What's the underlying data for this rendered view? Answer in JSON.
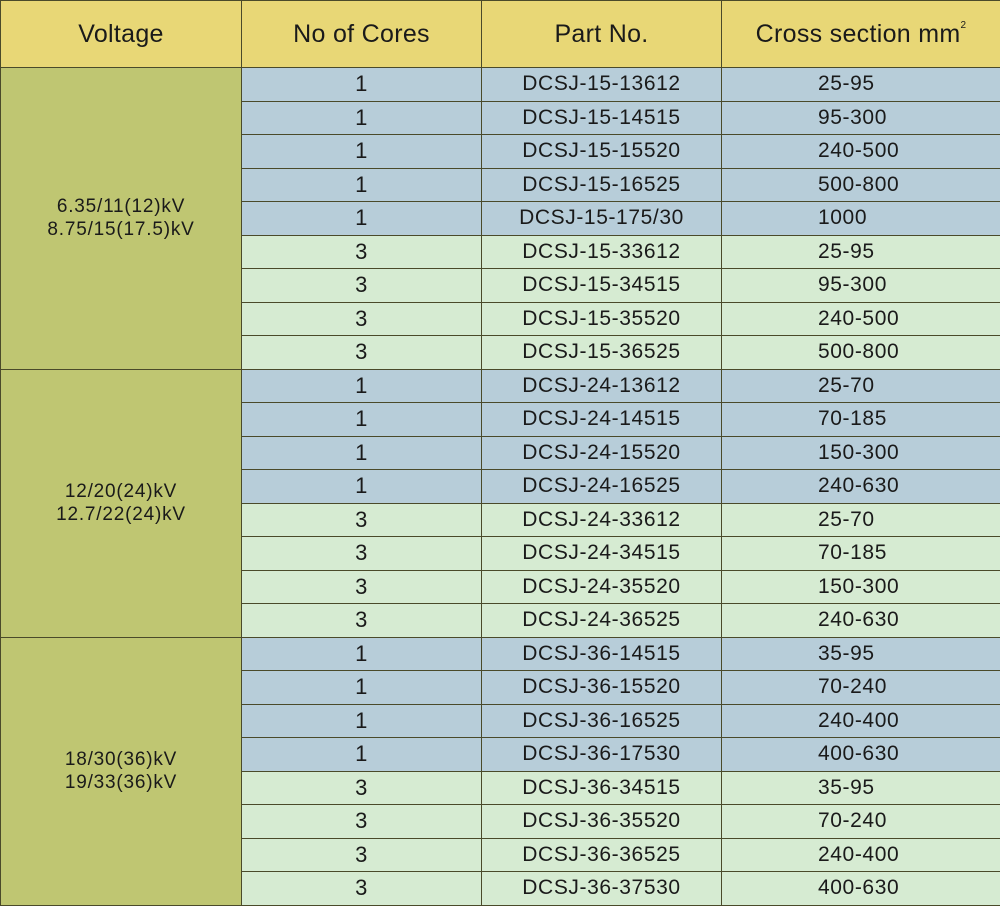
{
  "headers": {
    "voltage": "Voltage",
    "cores": "No of Cores",
    "part": "Part No.",
    "cross": "Cross section mm",
    "cross_sup": "2"
  },
  "groups": [
    {
      "voltage_lines": [
        "6.35/11(12)kV",
        "8.75/15(17.5)kV"
      ],
      "rows": [
        {
          "cores": "1",
          "part": "DCSJ-15-13612",
          "cross": "25-95"
        },
        {
          "cores": "1",
          "part": "DCSJ-15-14515",
          "cross": "95-300"
        },
        {
          "cores": "1",
          "part": "DCSJ-15-15520",
          "cross": "240-500"
        },
        {
          "cores": "1",
          "part": "DCSJ-15-16525",
          "cross": "500-800"
        },
        {
          "cores": "1",
          "part": "DCSJ-15-175/30",
          "cross": "1000"
        },
        {
          "cores": "3",
          "part": "DCSJ-15-33612",
          "cross": "25-95"
        },
        {
          "cores": "3",
          "part": "DCSJ-15-34515",
          "cross": "95-300"
        },
        {
          "cores": "3",
          "part": "DCSJ-15-35520",
          "cross": "240-500"
        },
        {
          "cores": "3",
          "part": "DCSJ-15-36525",
          "cross": "500-800"
        }
      ]
    },
    {
      "voltage_lines": [
        "12/20(24)kV",
        "12.7/22(24)kV"
      ],
      "rows": [
        {
          "cores": "1",
          "part": "DCSJ-24-13612",
          "cross": "25-70"
        },
        {
          "cores": "1",
          "part": "DCSJ-24-14515",
          "cross": "70-185"
        },
        {
          "cores": "1",
          "part": "DCSJ-24-15520",
          "cross": "150-300"
        },
        {
          "cores": "1",
          "part": "DCSJ-24-16525",
          "cross": "240-630"
        },
        {
          "cores": "3",
          "part": "DCSJ-24-33612",
          "cross": "25-70"
        },
        {
          "cores": "3",
          "part": "DCSJ-24-34515",
          "cross": "70-185"
        },
        {
          "cores": "3",
          "part": "DCSJ-24-35520",
          "cross": "150-300"
        },
        {
          "cores": "3",
          "part": "DCSJ-24-36525",
          "cross": "240-630"
        }
      ]
    },
    {
      "voltage_lines": [
        "18/30(36)kV",
        "19/33(36)kV"
      ],
      "rows": [
        {
          "cores": "1",
          "part": "DCSJ-36-14515",
          "cross": "35-95"
        },
        {
          "cores": "1",
          "part": "DCSJ-36-15520",
          "cross": "70-240"
        },
        {
          "cores": "1",
          "part": "DCSJ-36-16525",
          "cross": "240-400"
        },
        {
          "cores": "1",
          "part": "DCSJ-36-17530",
          "cross": "400-630"
        },
        {
          "cores": "3",
          "part": "DCSJ-36-34515",
          "cross": "35-95"
        },
        {
          "cores": "3",
          "part": "DCSJ-36-35520",
          "cross": "70-240"
        },
        {
          "cores": "3",
          "part": "DCSJ-36-36525",
          "cross": "240-400"
        },
        {
          "cores": "3",
          "part": "DCSJ-36-37530",
          "cross": "400-630"
        }
      ]
    }
  ]
}
